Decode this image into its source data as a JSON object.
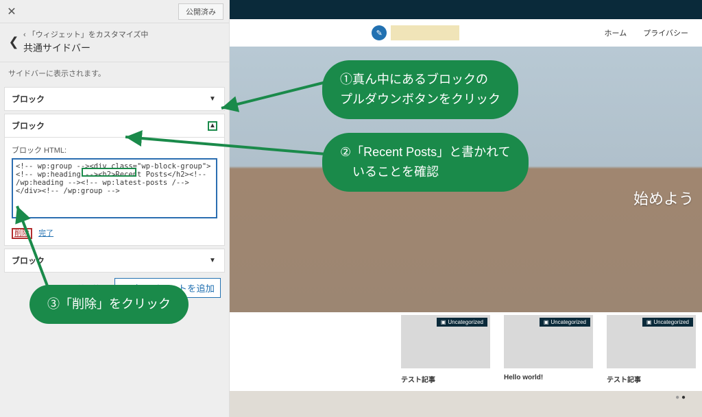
{
  "sidebar": {
    "published": "公開済み",
    "crumb": "「ウィジェット」をカスタマイズ中",
    "crumb_prefix": "‹",
    "title": "共通サイドバー",
    "desc": "サイドバーに表示されます。",
    "widgets": [
      {
        "label": "ブロック"
      },
      {
        "label": "ブロック"
      },
      {
        "label": "ブロック"
      }
    ],
    "html_label": "ブロック HTML:",
    "html_value": "<!-- wp:group --><div class=\"wp-block-group\"><!-- wp:heading --><h2>Recent Posts</h2><!-- /wp:heading --><!-- wp:latest-posts /--></div><!-- /wp:group -->",
    "delete": "削除",
    "done": "完了",
    "sort": "並べ替え",
    "add": "ウィジェットを追加"
  },
  "preview": {
    "nav": {
      "home": "ホーム",
      "privacy": "プライバシー"
    },
    "hero_text": "始めよう",
    "cards": [
      {
        "tag": "Uncategorized",
        "title": "テスト記事"
      },
      {
        "tag": "Uncategorized",
        "title": "Hello world!"
      },
      {
        "tag": "Uncategorized",
        "title": "テスト記事"
      }
    ]
  },
  "callouts": {
    "c1a": "①真ん中にあるブロックの",
    "c1b": "プルダウンボタンをクリック",
    "c2a": "②「Recent Posts」と書かれて",
    "c2b": "　いることを確認",
    "c3": "③「削除」をクリック"
  }
}
